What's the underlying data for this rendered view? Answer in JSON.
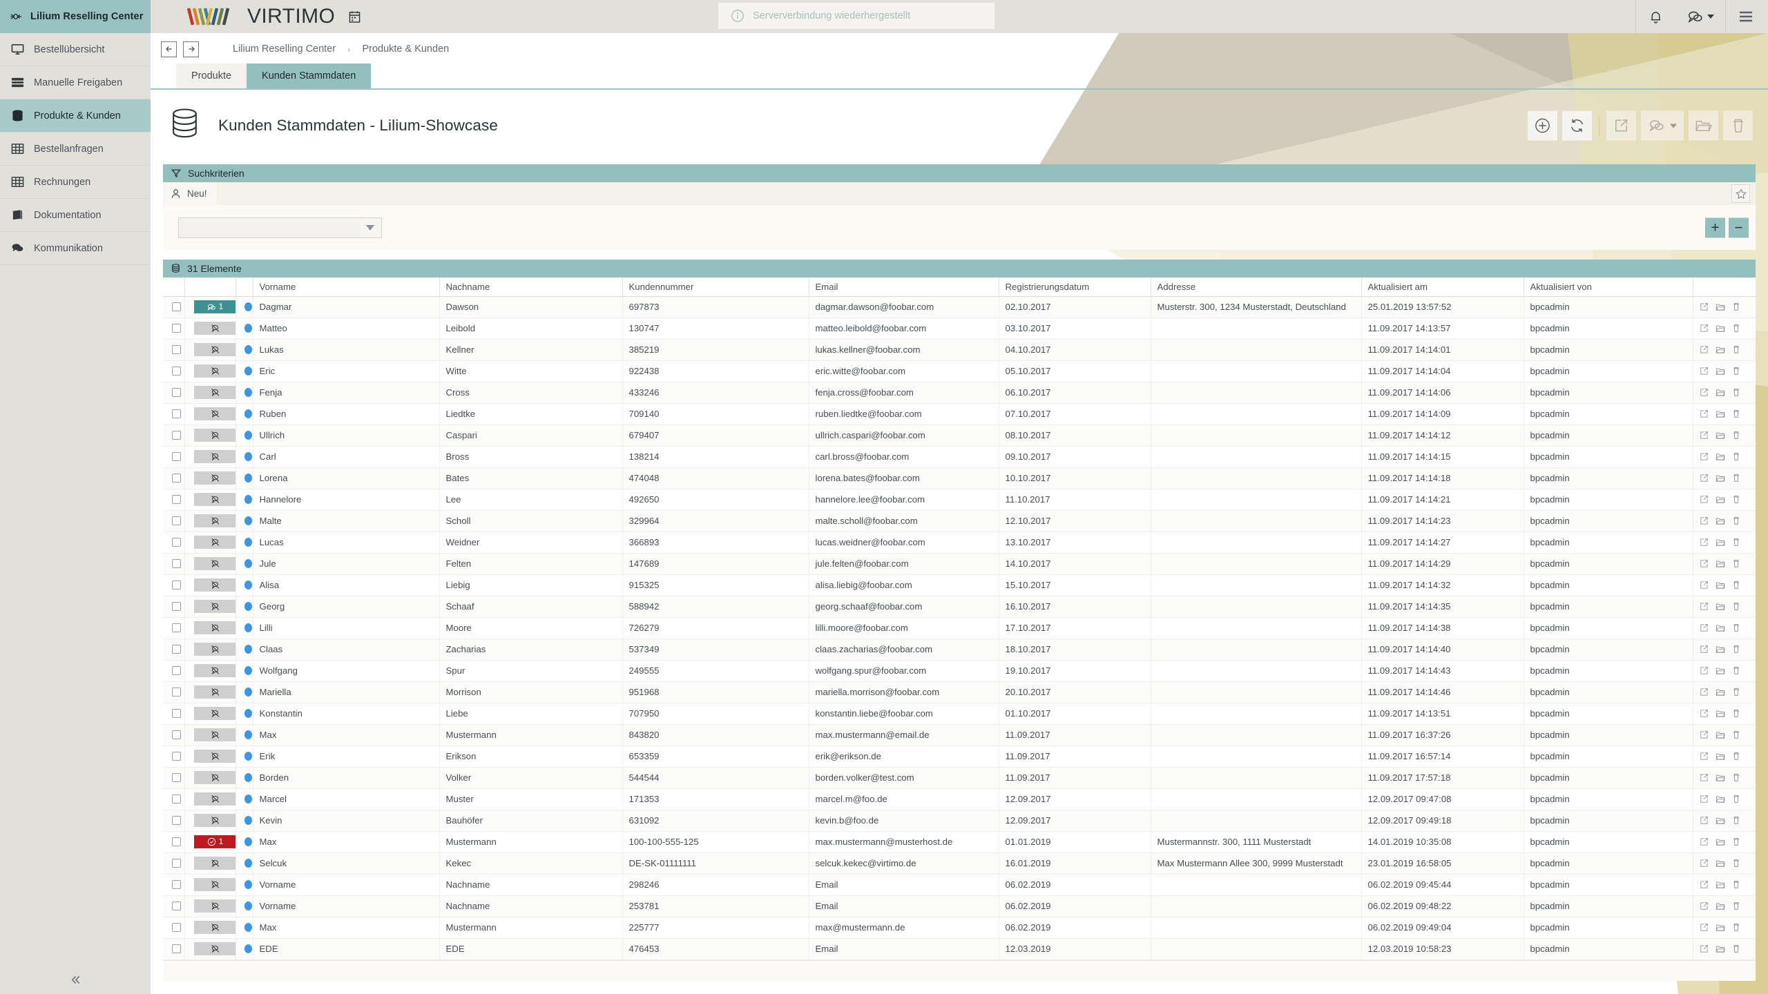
{
  "sidebar": {
    "brand": {
      "label": "Lilium Reselling Center",
      "icon": "rocket-icon"
    },
    "items": [
      {
        "label": "Bestellübersicht",
        "icon": "monitor-icon",
        "active": false
      },
      {
        "label": "Manuelle Freigaben",
        "icon": "server-stack-icon",
        "active": false
      },
      {
        "label": "Produkte & Kunden",
        "icon": "database-icon",
        "active": true
      },
      {
        "label": "Bestellanfragen",
        "icon": "table-icon",
        "active": false
      },
      {
        "label": "Rechnungen",
        "icon": "table-icon",
        "active": false
      },
      {
        "label": "Dokumentation",
        "icon": "book-icon",
        "active": false
      },
      {
        "label": "Kommunikation",
        "icon": "chat-icon",
        "active": false
      }
    ],
    "collapse_icon": "chevron-double-left-icon"
  },
  "topbar": {
    "logo_text": "VIRTIMO",
    "calendar_icon": "calendar-icon",
    "toast": {
      "icon": "info-icon",
      "text": "Serververbindung wiederhergestellt"
    },
    "actions": [
      {
        "name": "notifications-button",
        "icon": "bell-icon"
      },
      {
        "name": "messages-button",
        "icon": "chat-icon"
      },
      {
        "name": "menu-button",
        "icon": "hamburger-icon"
      }
    ]
  },
  "breadcrumb": {
    "back_icon": "arrow-left-icon",
    "forward_icon": "arrow-right-icon",
    "items": [
      "Lilium Reselling Center",
      "Produkte & Kunden"
    ],
    "separator": "›"
  },
  "tabs": [
    {
      "label": "Produkte",
      "active": false
    },
    {
      "label": "Kunden Stammdaten",
      "active": true
    }
  ],
  "page": {
    "icon": "database-icon",
    "title": "Kunden Stammdaten - Lilium-Showcase",
    "tools": [
      {
        "name": "add-button",
        "icon": "plus-circle-icon",
        "dim": false
      },
      {
        "name": "refresh-button",
        "icon": "refresh-icon",
        "dim": false
      },
      {
        "name": "open-button",
        "icon": "external-link-icon",
        "dim": true
      },
      {
        "name": "comments-button",
        "icon": "chat-icon",
        "dim": true
      },
      {
        "name": "folder-button",
        "icon": "folder-open-icon",
        "dim": true
      },
      {
        "name": "delete-button",
        "icon": "trash-icon",
        "dim": true
      }
    ]
  },
  "search_panel": {
    "title": "Suchkriterien",
    "filter_icon": "filter-icon",
    "new_button": {
      "label": "Neu!",
      "icon": "user-icon"
    },
    "favorite_icon": "star-icon",
    "criteria_select": {
      "value": "",
      "placeholder": ""
    },
    "add_label": "+",
    "remove_label": "−"
  },
  "table": {
    "count_label": "31 Elemente",
    "count_icon": "database-icon",
    "columns": [
      "",
      "",
      "",
      "Vorname",
      "Nachname",
      "Kundennummer",
      "Email",
      "Registrierungsdatum",
      "Addresse",
      "Aktualisiert am",
      "Aktualisiert von",
      ""
    ],
    "row_action_icons": [
      "edit-icon",
      "folder-open-icon",
      "trash-icon"
    ],
    "rows": [
      {
        "badge": {
          "type": "teal",
          "icon": "chat-icon",
          "count": "1"
        },
        "vorname": "Dagmar",
        "nachname": "Dawson",
        "kundennummer": "697873",
        "email": "dagmar.dawson@foobar.com",
        "registrierung": "02.10.2017",
        "adresse": "Musterstr. 300, 1234 Musterstadt, Deutschland",
        "aktualisiert_am": "25.01.2019 13:57:52",
        "aktualisiert_von": "bpcadmin"
      },
      {
        "badge": {
          "type": "gray",
          "icon": "chat-off-icon",
          "count": ""
        },
        "vorname": "Matteo",
        "nachname": "Leibold",
        "kundennummer": "130747",
        "email": "matteo.leibold@foobar.com",
        "registrierung": "03.10.2017",
        "adresse": "",
        "aktualisiert_am": "11.09.2017 14:13:57",
        "aktualisiert_von": "bpcadmin"
      },
      {
        "badge": {
          "type": "gray",
          "icon": "chat-off-icon",
          "count": ""
        },
        "vorname": "Lukas",
        "nachname": "Kellner",
        "kundennummer": "385219",
        "email": "lukas.kellner@foobar.com",
        "registrierung": "04.10.2017",
        "adresse": "",
        "aktualisiert_am": "11.09.2017 14:14:01",
        "aktualisiert_von": "bpcadmin"
      },
      {
        "badge": {
          "type": "gray",
          "icon": "chat-off-icon",
          "count": ""
        },
        "vorname": "Eric",
        "nachname": "Witte",
        "kundennummer": "922438",
        "email": "eric.witte@foobar.com",
        "registrierung": "05.10.2017",
        "adresse": "",
        "aktualisiert_am": "11.09.2017 14:14:04",
        "aktualisiert_von": "bpcadmin"
      },
      {
        "badge": {
          "type": "gray",
          "icon": "chat-off-icon",
          "count": ""
        },
        "vorname": "Fenja",
        "nachname": "Cross",
        "kundennummer": "433246",
        "email": "fenja.cross@foobar.com",
        "registrierung": "06.10.2017",
        "adresse": "",
        "aktualisiert_am": "11.09.2017 14:14:06",
        "aktualisiert_von": "bpcadmin"
      },
      {
        "badge": {
          "type": "gray",
          "icon": "chat-off-icon",
          "count": ""
        },
        "vorname": "Ruben",
        "nachname": "Liedtke",
        "kundennummer": "709140",
        "email": "ruben.liedtke@foobar.com",
        "registrierung": "07.10.2017",
        "adresse": "",
        "aktualisiert_am": "11.09.2017 14:14:09",
        "aktualisiert_von": "bpcadmin"
      },
      {
        "badge": {
          "type": "gray",
          "icon": "chat-off-icon",
          "count": ""
        },
        "vorname": "Ullrich",
        "nachname": "Caspari",
        "kundennummer": "679407",
        "email": "ullrich.caspari@foobar.com",
        "registrierung": "08.10.2017",
        "adresse": "",
        "aktualisiert_am": "11.09.2017 14:14:12",
        "aktualisiert_von": "bpcadmin"
      },
      {
        "badge": {
          "type": "gray",
          "icon": "chat-off-icon",
          "count": ""
        },
        "vorname": "Carl",
        "nachname": "Bross",
        "kundennummer": "138214",
        "email": "carl.bross@foobar.com",
        "registrierung": "09.10.2017",
        "adresse": "",
        "aktualisiert_am": "11.09.2017 14:14:15",
        "aktualisiert_von": "bpcadmin"
      },
      {
        "badge": {
          "type": "gray",
          "icon": "chat-off-icon",
          "count": ""
        },
        "vorname": "Lorena",
        "nachname": "Bates",
        "kundennummer": "474048",
        "email": "lorena.bates@foobar.com",
        "registrierung": "10.10.2017",
        "adresse": "",
        "aktualisiert_am": "11.09.2017 14:14:18",
        "aktualisiert_von": "bpcadmin"
      },
      {
        "badge": {
          "type": "gray",
          "icon": "chat-off-icon",
          "count": ""
        },
        "vorname": "Hannelore",
        "nachname": "Lee",
        "kundennummer": "492650",
        "email": "hannelore.lee@foobar.com",
        "registrierung": "11.10.2017",
        "adresse": "",
        "aktualisiert_am": "11.09.2017 14:14:21",
        "aktualisiert_von": "bpcadmin"
      },
      {
        "badge": {
          "type": "gray",
          "icon": "chat-off-icon",
          "count": ""
        },
        "vorname": "Malte",
        "nachname": "Scholl",
        "kundennummer": "329964",
        "email": "malte.scholl@foobar.com",
        "registrierung": "12.10.2017",
        "adresse": "",
        "aktualisiert_am": "11.09.2017 14:14:23",
        "aktualisiert_von": "bpcadmin"
      },
      {
        "badge": {
          "type": "gray",
          "icon": "chat-off-icon",
          "count": ""
        },
        "vorname": "Lucas",
        "nachname": "Weidner",
        "kundennummer": "366893",
        "email": "lucas.weidner@foobar.com",
        "registrierung": "13.10.2017",
        "adresse": "",
        "aktualisiert_am": "11.09.2017 14:14:27",
        "aktualisiert_von": "bpcadmin"
      },
      {
        "badge": {
          "type": "gray",
          "icon": "chat-off-icon",
          "count": ""
        },
        "vorname": "Jule",
        "nachname": "Felten",
        "kundennummer": "147689",
        "email": "jule.felten@foobar.com",
        "registrierung": "14.10.2017",
        "adresse": "",
        "aktualisiert_am": "11.09.2017 14:14:29",
        "aktualisiert_von": "bpcadmin"
      },
      {
        "badge": {
          "type": "gray",
          "icon": "chat-off-icon",
          "count": ""
        },
        "vorname": "Alisa",
        "nachname": "Liebig",
        "kundennummer": "915325",
        "email": "alisa.liebig@foobar.com",
        "registrierung": "15.10.2017",
        "adresse": "",
        "aktualisiert_am": "11.09.2017 14:14:32",
        "aktualisiert_von": "bpcadmin"
      },
      {
        "badge": {
          "type": "gray",
          "icon": "chat-off-icon",
          "count": ""
        },
        "vorname": "Georg",
        "nachname": "Schaaf",
        "kundennummer": "588942",
        "email": "georg.schaaf@foobar.com",
        "registrierung": "16.10.2017",
        "adresse": "",
        "aktualisiert_am": "11.09.2017 14:14:35",
        "aktualisiert_von": "bpcadmin"
      },
      {
        "badge": {
          "type": "gray",
          "icon": "chat-off-icon",
          "count": ""
        },
        "vorname": "Lilli",
        "nachname": "Moore",
        "kundennummer": "726279",
        "email": "lilli.moore@foobar.com",
        "registrierung": "17.10.2017",
        "adresse": "",
        "aktualisiert_am": "11.09.2017 14:14:38",
        "aktualisiert_von": "bpcadmin"
      },
      {
        "badge": {
          "type": "gray",
          "icon": "chat-off-icon",
          "count": ""
        },
        "vorname": "Claas",
        "nachname": "Zacharias",
        "kundennummer": "537349",
        "email": "claas.zacharias@foobar.com",
        "registrierung": "18.10.2017",
        "adresse": "",
        "aktualisiert_am": "11.09.2017 14:14:40",
        "aktualisiert_von": "bpcadmin"
      },
      {
        "badge": {
          "type": "gray",
          "icon": "chat-off-icon",
          "count": ""
        },
        "vorname": "Wolfgang",
        "nachname": "Spur",
        "kundennummer": "249555",
        "email": "wolfgang.spur@foobar.com",
        "registrierung": "19.10.2017",
        "adresse": "",
        "aktualisiert_am": "11.09.2017 14:14:43",
        "aktualisiert_von": "bpcadmin"
      },
      {
        "badge": {
          "type": "gray",
          "icon": "chat-off-icon",
          "count": ""
        },
        "vorname": "Mariella",
        "nachname": "Morrison",
        "kundennummer": "951968",
        "email": "mariella.morrison@foobar.com",
        "registrierung": "20.10.2017",
        "adresse": "",
        "aktualisiert_am": "11.09.2017 14:14:46",
        "aktualisiert_von": "bpcadmin"
      },
      {
        "badge": {
          "type": "gray",
          "icon": "chat-off-icon",
          "count": ""
        },
        "vorname": "Konstantin",
        "nachname": "Liebe",
        "kundennummer": "707950",
        "email": "konstantin.liebe@foobar.com",
        "registrierung": "01.10.2017",
        "adresse": "",
        "aktualisiert_am": "11.09.2017 14:13:51",
        "aktualisiert_von": "bpcadmin"
      },
      {
        "badge": {
          "type": "gray",
          "icon": "chat-off-icon",
          "count": ""
        },
        "vorname": "Max",
        "nachname": "Mustermann",
        "kundennummer": "843820",
        "email": "max.mustermann@email.de",
        "registrierung": "11.09.2017",
        "adresse": "",
        "aktualisiert_am": "11.09.2017 16:37:26",
        "aktualisiert_von": "bpcadmin"
      },
      {
        "badge": {
          "type": "gray",
          "icon": "chat-off-icon",
          "count": ""
        },
        "vorname": "Erik",
        "nachname": "Erikson",
        "kundennummer": "653359",
        "email": "erik@erikson.de",
        "registrierung": "11.09.2017",
        "adresse": "",
        "aktualisiert_am": "11.09.2017 16:57:14",
        "aktualisiert_von": "bpcadmin"
      },
      {
        "badge": {
          "type": "gray",
          "icon": "chat-off-icon",
          "count": ""
        },
        "vorname": "Borden",
        "nachname": "Volker",
        "kundennummer": "544544",
        "email": "borden.volker@test.com",
        "registrierung": "11.09.2017",
        "adresse": "",
        "aktualisiert_am": "11.09.2017 17:57:18",
        "aktualisiert_von": "bpcadmin"
      },
      {
        "badge": {
          "type": "gray",
          "icon": "chat-off-icon",
          "count": ""
        },
        "vorname": "Marcel",
        "nachname": "Muster",
        "kundennummer": "171353",
        "email": "marcel.m@foo.de",
        "registrierung": "12.09.2017",
        "adresse": "",
        "aktualisiert_am": "12.09.2017 09:47:08",
        "aktualisiert_von": "bpcadmin"
      },
      {
        "badge": {
          "type": "gray",
          "icon": "chat-off-icon",
          "count": ""
        },
        "vorname": "Kevin",
        "nachname": "Bauhöfer",
        "kundennummer": "631092",
        "email": "kevin.b@foo.de",
        "registrierung": "12.09.2017",
        "adresse": "",
        "aktualisiert_am": "12.09.2017 09:49:18",
        "aktualisiert_von": "bpcadmin"
      },
      {
        "badge": {
          "type": "red",
          "icon": "check-circle-icon",
          "count": "1"
        },
        "vorname": "Max",
        "nachname": "Mustermann",
        "kundennummer": "100-100-555-125",
        "email": "max.mustermann@musterhost.de",
        "registrierung": "01.01.2019",
        "adresse": "Mustermannstr. 300, 1111 Musterstadt",
        "aktualisiert_am": "14.01.2019 10:35:08",
        "aktualisiert_von": "bpcadmin"
      },
      {
        "badge": {
          "type": "gray",
          "icon": "chat-off-icon",
          "count": ""
        },
        "vorname": "Selcuk",
        "nachname": "Kekec",
        "kundennummer": "DE-SK-01111111",
        "email": "selcuk.kekec@virtimo.de",
        "registrierung": "16.01.2019",
        "adresse": "Max Mustermann Allee 300, 9999 Musterstadt",
        "aktualisiert_am": "23.01.2019 16:58:05",
        "aktualisiert_von": "bpcadmin"
      },
      {
        "badge": {
          "type": "gray",
          "icon": "chat-off-icon",
          "count": ""
        },
        "vorname": "Vorname",
        "nachname": "Nachname",
        "kundennummer": "298246",
        "email": "Email",
        "registrierung": "06.02.2019",
        "adresse": "",
        "aktualisiert_am": "06.02.2019 09:45:44",
        "aktualisiert_von": "bpcadmin"
      },
      {
        "badge": {
          "type": "gray",
          "icon": "chat-off-icon",
          "count": ""
        },
        "vorname": "Vorname",
        "nachname": "Nachname",
        "kundennummer": "253781",
        "email": "Email",
        "registrierung": "06.02.2019",
        "adresse": "",
        "aktualisiert_am": "06.02.2019 09:48:22",
        "aktualisiert_von": "bpcadmin"
      },
      {
        "badge": {
          "type": "gray",
          "icon": "chat-off-icon",
          "count": ""
        },
        "vorname": "Max",
        "nachname": "Mustermann",
        "kundennummer": "225777",
        "email": "max@mustermann.de",
        "registrierung": "06.02.2019",
        "adresse": "",
        "aktualisiert_am": "06.02.2019 09:49:04",
        "aktualisiert_von": "bpcadmin"
      },
      {
        "badge": {
          "type": "gray",
          "icon": "chat-off-icon",
          "count": ""
        },
        "vorname": "EDE",
        "nachname": "EDE",
        "kundennummer": "476453",
        "email": "Email",
        "registrierung": "12.03.2019",
        "adresse": "",
        "aktualisiert_am": "12.03.2019 10:58:23",
        "aktualisiert_von": "bpcadmin"
      }
    ]
  },
  "colors": {
    "accent_teal": "#93bfbe",
    "sidebar_bg": "#e2e0da",
    "badge_teal": "#3d9190",
    "badge_red": "#bb1b21",
    "status_dot_blue": "#3f95e0"
  }
}
